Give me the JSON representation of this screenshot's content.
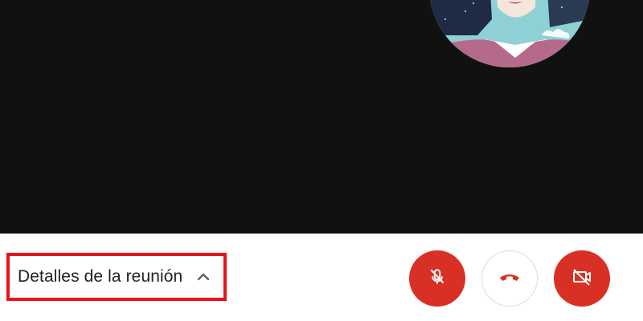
{
  "meeting": {
    "details_label": "Detalles de la reunión"
  },
  "controls": {
    "mic_icon": "mic-off-icon",
    "hangup_icon": "hang-up-icon",
    "camera_icon": "video-off-icon"
  },
  "colors": {
    "video_background": "#111111",
    "control_red": "#d93025",
    "highlight_border": "#e8141c",
    "hangup_glyph": "#d93025"
  }
}
